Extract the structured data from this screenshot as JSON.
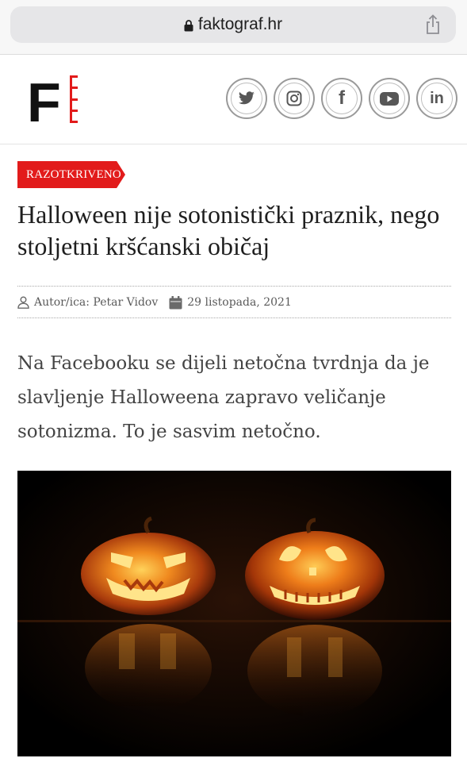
{
  "browser": {
    "domain": "faktograf.hr"
  },
  "site": {
    "logo_letter": "F",
    "social": [
      {
        "name": "twitter",
        "glyph": ""
      },
      {
        "name": "instagram",
        "glyph": ""
      },
      {
        "name": "facebook",
        "glyph": "f"
      },
      {
        "name": "youtube",
        "glyph": ""
      },
      {
        "name": "linkedin",
        "glyph": "in"
      }
    ]
  },
  "article": {
    "badge": "RAZOTKRIVENO",
    "title": "Halloween nije sotonistički praznik, nego stoljetni kršćanski običaj",
    "author": "Autor/ica: Petar Vidov",
    "date": "29 listopada, 2021",
    "lead": "Na Facebooku se dijeli netočna tvrdnja da je slavljenje Halloweena zapravo veličanje sotonizma. To je sasvim netočno."
  },
  "colors": {
    "accent": "#e21b1b",
    "text": "#1e1e1e",
    "muted": "#5a5a5a"
  }
}
